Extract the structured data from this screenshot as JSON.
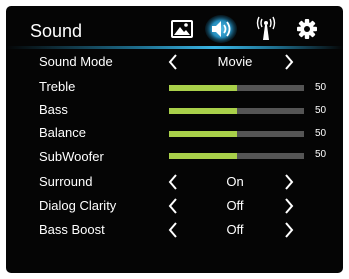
{
  "menu": {
    "title": "Sound",
    "tabs": [
      {
        "name": "picture",
        "icon": "picture-icon",
        "active": false
      },
      {
        "name": "sound",
        "icon": "speaker-icon",
        "active": true
      },
      {
        "name": "network",
        "icon": "antenna-icon",
        "active": false
      },
      {
        "name": "settings",
        "icon": "gear-icon",
        "active": false
      }
    ]
  },
  "rows": {
    "sound_mode": {
      "label": "Sound Mode",
      "value": "Movie"
    },
    "treble": {
      "label": "Treble",
      "level": 50,
      "max": 100,
      "display": "50"
    },
    "bass": {
      "label": "Bass",
      "level": 50,
      "max": 100,
      "display": "50"
    },
    "balance": {
      "label": "Balance",
      "level": 50,
      "max": 100,
      "display": "50"
    },
    "subwoofer": {
      "label": "SubWoofer",
      "level": 50,
      "max": 100,
      "display": "50"
    },
    "surround": {
      "label": "Surround",
      "value": "On"
    },
    "dialog_clarity": {
      "label": "Dialog Clarity",
      "value": "Off"
    },
    "bass_boost": {
      "label": "Bass Boost",
      "value": "Off"
    }
  },
  "colors": {
    "background": "#050505",
    "slider_fill": "#a9d04a",
    "slider_track": "#555555",
    "active_tab": "#2aa4dc",
    "text": "#ffffff"
  }
}
